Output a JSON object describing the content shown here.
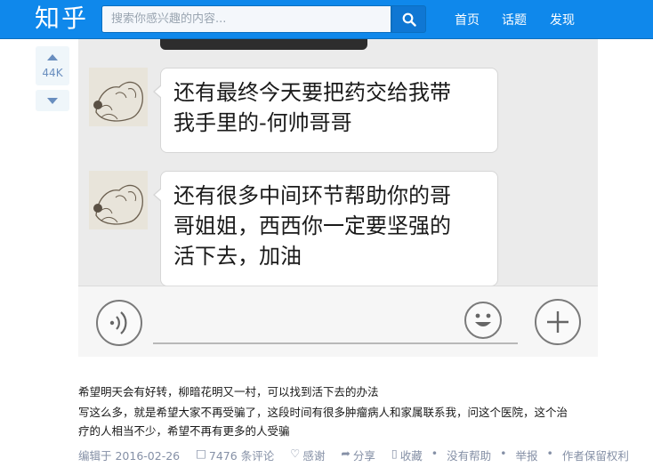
{
  "header": {
    "logo": "知乎",
    "search_placeholder": "搜索你感兴趣的内容...",
    "nav": [
      "首页",
      "话题",
      "发现"
    ],
    "brand_color": "#0f88eb"
  },
  "vote": {
    "count": "44K"
  },
  "chat": {
    "messages": [
      "还有最终今天要把药交给我带我手里的-何帅哥哥",
      "还有很多中间环节帮助你的哥哥姐姐，西西你一定要坚强的活下去，加油"
    ],
    "message_lines": [
      [
        "还有最终今天要把药交给我带",
        "我手里的-何帅哥哥"
      ],
      [
        "还有很多中间环节帮助你的哥",
        "哥姐姐，西西你一定要坚强的",
        "活下去，加油"
      ]
    ]
  },
  "answer": {
    "lines": [
      "希望明天会有好转，柳暗花明又一村，可以找到活下去的办法",
      "写这么多，就是希望大家不再受骗了，这段时间有很多肿瘤病人和家属联系我，问这个医院，这个治",
      "疗的人相当不少，希望不再有更多的人受骗"
    ]
  },
  "meta": {
    "edited": "编辑于 2016-02-26",
    "comments": "7476 条评论",
    "thanks": "感谢",
    "share": "分享",
    "collect": "收藏",
    "no_help": "没有帮助",
    "report": "举报",
    "rights": "作者保留权利",
    "separator": "•"
  }
}
